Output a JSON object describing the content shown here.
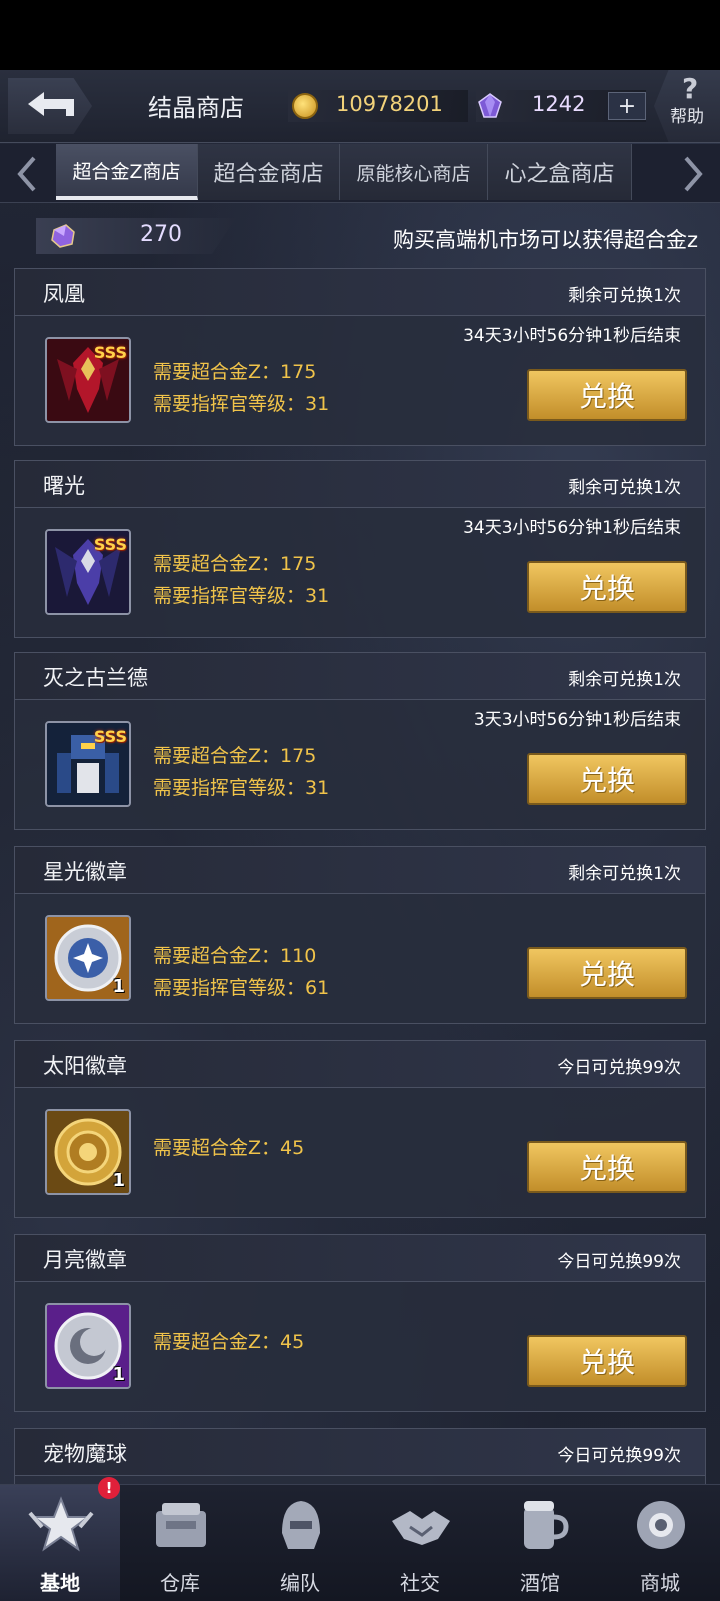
{
  "header": {
    "title": "结晶商店",
    "coins": "10978201",
    "gems": "1242",
    "plus_label": "+",
    "help_label": "帮助",
    "help_glyph": "?"
  },
  "tabs": [
    {
      "label": "超合金Z商店",
      "active": true
    },
    {
      "label": "超合金商店",
      "active": false
    },
    {
      "label": "原能核心商店",
      "active": false
    },
    {
      "label": "心之盒商店",
      "active": false
    }
  ],
  "info": {
    "crystal_amount": "270",
    "message": "购买高端机市场可以获得超合金z"
  },
  "items": [
    {
      "name": "凤凰",
      "limit": "剩余可兑换1次",
      "timer": "34天3小时56分钟1秒后结束",
      "badge": "SSS",
      "req_alloy": "需要超合金Z：175",
      "req_level": "需要指挥官等级：31",
      "button": "兑换",
      "icon": "robot-red-icon"
    },
    {
      "name": "曙光",
      "limit": "剩余可兑换1次",
      "timer": "34天3小时56分钟1秒后结束",
      "badge": "SSS",
      "req_alloy": "需要超合金Z：175",
      "req_level": "需要指挥官等级：31",
      "button": "兑换",
      "icon": "robot-purple-icon"
    },
    {
      "name": "灭之古兰德",
      "limit": "剩余可兑换1次",
      "timer": "3天3小时56分钟1秒后结束",
      "badge": "SSS",
      "req_alloy": "需要超合金Z：175",
      "req_level": "需要指挥官等级：31",
      "button": "兑换",
      "icon": "robot-blue-icon"
    },
    {
      "name": "星光徽章",
      "limit": "剩余可兑换1次",
      "qty": "1",
      "req_alloy": "需要超合金Z：110",
      "req_level": "需要指挥官等级：61",
      "button": "兑换",
      "icon": "star-badge-icon"
    },
    {
      "name": "太阳徽章",
      "limit": "今日可兑换99次",
      "qty": "1",
      "req_alloy": "需要超合金Z：45",
      "button": "兑换",
      "icon": "sun-badge-icon"
    },
    {
      "name": "月亮徽章",
      "limit": "今日可兑换99次",
      "qty": "1",
      "req_alloy": "需要超合金Z：45",
      "button": "兑换",
      "icon": "moon-badge-icon"
    },
    {
      "name": "宠物魔球",
      "limit": "今日可兑换99次"
    }
  ],
  "nav": [
    {
      "label": "基地",
      "icon": "base-star-icon",
      "active": true,
      "badge": "!"
    },
    {
      "label": "仓库",
      "icon": "warehouse-icon",
      "active": false
    },
    {
      "label": "编队",
      "icon": "formation-helmet-icon",
      "active": false
    },
    {
      "label": "社交",
      "icon": "handshake-icon",
      "active": false
    },
    {
      "label": "酒馆",
      "icon": "tavern-icon",
      "active": false
    },
    {
      "label": "商城",
      "icon": "mall-orb-icon",
      "active": false
    }
  ],
  "colors": {
    "gold_text": "#f0c34a",
    "button_gold": "#e2b24a",
    "alert_red": "#e0203a"
  }
}
